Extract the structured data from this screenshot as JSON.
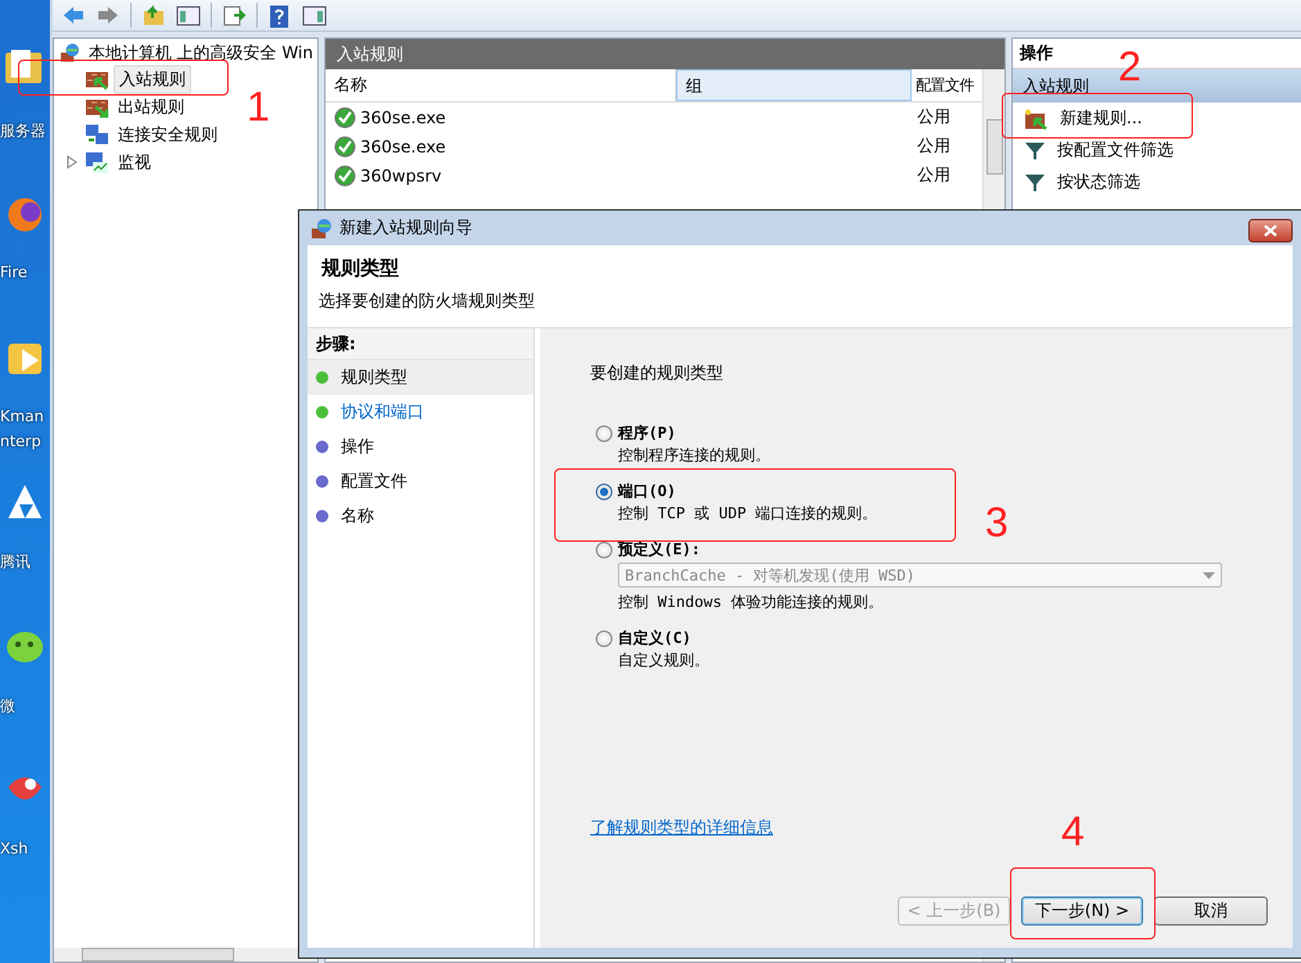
{
  "desktop_icons": [
    {
      "label": "服务器"
    },
    {
      "label": "Fire"
    },
    {
      "label": "Kman"
    },
    {
      "label": "nterp"
    },
    {
      "label": "腾讯"
    },
    {
      "label": "微"
    },
    {
      "label": "Xsh"
    }
  ],
  "tree": {
    "root": "本地计算机 上的高级安全 Win",
    "items": [
      {
        "label": "入站规则",
        "selected": true,
        "expandable": false,
        "kind": "inbound"
      },
      {
        "label": "出站规则",
        "selected": false,
        "expandable": false,
        "kind": "outbound"
      },
      {
        "label": "连接安全规则",
        "selected": false,
        "expandable": false,
        "kind": "computers"
      },
      {
        "label": "监视",
        "selected": false,
        "expandable": true,
        "kind": "monitor"
      }
    ]
  },
  "rules_pane": {
    "title": "入站规则",
    "columns": [
      "名称",
      "组",
      "配置文件"
    ],
    "rows": [
      {
        "name": "360se.exe",
        "profile": "公用"
      },
      {
        "name": "360se.exe",
        "profile": "公用"
      },
      {
        "name": "360wpsrv",
        "profile": "公用"
      }
    ]
  },
  "actions_pane": {
    "title": "操作",
    "section": "入站规则",
    "items": [
      {
        "label": "新建规则...",
        "kind": "new"
      },
      {
        "label": "按配置文件筛选",
        "kind": "filter"
      },
      {
        "label": "按状态筛选",
        "kind": "filter"
      }
    ]
  },
  "dialog": {
    "title": "新建入站规则向导",
    "heading": "规则类型",
    "subheading": "选择要创建的防火墙规则类型",
    "steps_title": "步骤:",
    "steps": [
      {
        "label": "规则类型",
        "selected": true,
        "kind": "text",
        "color": "#4cbf3a"
      },
      {
        "label": "协议和端口",
        "selected": false,
        "kind": "link",
        "color": "#4cbf3a"
      },
      {
        "label": "操作",
        "selected": false,
        "kind": "text",
        "color": "#6a6acc"
      },
      {
        "label": "配置文件",
        "selected": false,
        "kind": "text",
        "color": "#6a6acc"
      },
      {
        "label": "名称",
        "selected": false,
        "kind": "text",
        "color": "#6a6acc"
      }
    ],
    "prompt": "要创建的规则类型",
    "options": [
      {
        "label": "程序(P)",
        "description": "控制程序连接的规则。",
        "selected": false
      },
      {
        "label": "端口(O)",
        "description": "控制 TCP 或 UDP 端口连接的规则。",
        "selected": true
      },
      {
        "label": "预定义(E):",
        "dropdown": {
          "value": "BranchCache - 对等机发现(使用 WSD)",
          "disabled": true
        },
        "description": "控制 Windows 体验功能连接的规则。",
        "selected": false
      },
      {
        "label": "自定义(C)",
        "description": "自定义规则。",
        "selected": false
      }
    ],
    "link": "了解规则类型的详细信息",
    "buttons": [
      {
        "label": "< 上一步(B)",
        "disabled": true,
        "default": false
      },
      {
        "label": "下一步(N) >",
        "disabled": false,
        "default": true
      },
      {
        "label": "取消",
        "disabled": false,
        "default": false
      }
    ]
  },
  "annotations": [
    {
      "label": "1"
    },
    {
      "label": "2"
    },
    {
      "label": "3"
    },
    {
      "label": "4"
    }
  ]
}
